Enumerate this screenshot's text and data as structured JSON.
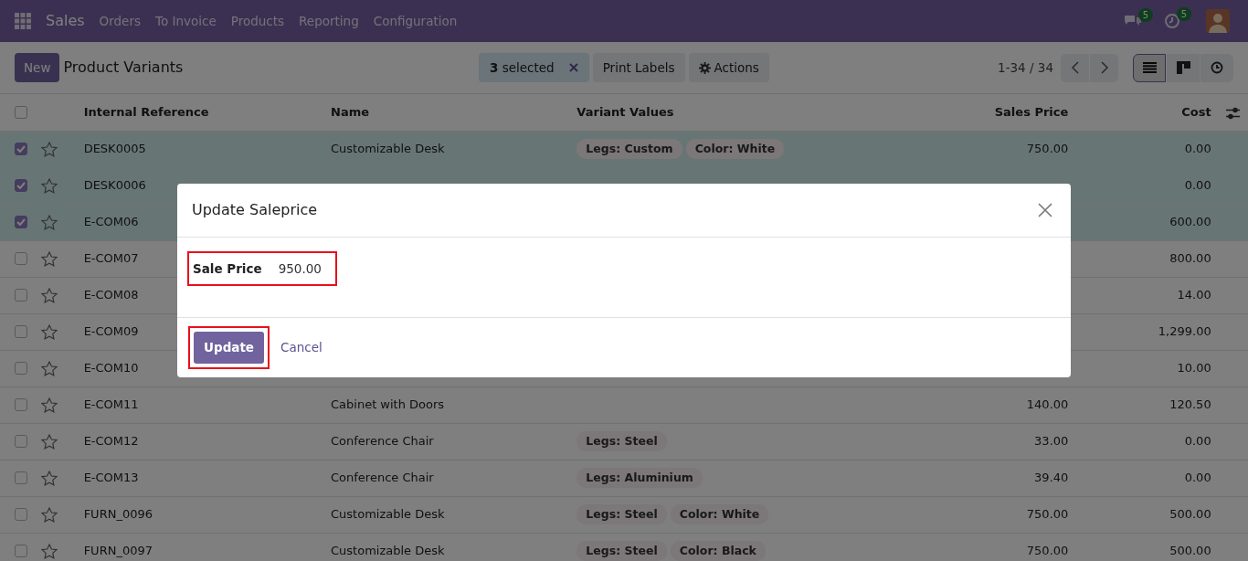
{
  "navbar": {
    "app": "Sales",
    "menus": [
      "Orders",
      "To Invoice",
      "Products",
      "Reporting",
      "Configuration"
    ],
    "messages_badge": "5",
    "activities_badge": "5"
  },
  "control_panel": {
    "new_button": "New",
    "title": "Product Variants",
    "selection": "**3** selected",
    "buttons": [
      {
        "kind": "plain",
        "label": "Print Labels"
      },
      {
        "kind": "gear",
        "label": "Actions"
      }
    ],
    "pager": "1-34 / 34",
    "views": [
      {
        "kind": "list",
        "selected": true
      },
      {
        "kind": "kanban",
        "selected": false
      },
      {
        "kind": "activity",
        "selected": false
      }
    ]
  },
  "table": {
    "all_selected": false,
    "columns": [
      "Internal Reference",
      "Name",
      "Variant Values",
      "Sales Price",
      "Cost"
    ],
    "rows": [
      {
        "selected": true,
        "starred": false,
        "reference": "DESK0005",
        "name": "Customizable Desk",
        "variants": [
          "Legs: Custom",
          "Color: White"
        ],
        "sales_price": "750.00",
        "cost": "0.00"
      },
      {
        "selected": true,
        "starred": false,
        "reference": "DESK0006",
        "cost": "0.00"
      },
      {
        "selected": true,
        "starred": false,
        "reference": "E-COM06",
        "cost": "600.00"
      },
      {
        "selected": false,
        "starred": false,
        "reference": "E-COM07",
        "cost": "800.00"
      },
      {
        "selected": false,
        "starred": false,
        "reference": "E-COM08",
        "cost": "14.00"
      },
      {
        "selected": false,
        "starred": false,
        "reference": "E-COM09",
        "cost": "1,299.00"
      },
      {
        "selected": false,
        "starred": false,
        "reference": "E-COM10",
        "cost": "10.00"
      },
      {
        "selected": false,
        "starred": false,
        "reference": "E-COM11",
        "name": "Cabinet with Doors",
        "variants": [],
        "sales_price": "140.00",
        "cost": "120.50"
      },
      {
        "selected": false,
        "starred": false,
        "reference": "E-COM12",
        "name": "Conference Chair",
        "variants": [
          "Legs: Steel"
        ],
        "sales_price": "33.00",
        "cost": "0.00"
      },
      {
        "selected": false,
        "starred": false,
        "reference": "E-COM13",
        "name": "Conference Chair",
        "variants": [
          "Legs: Aluminium"
        ],
        "sales_price": "39.40",
        "cost": "0.00"
      },
      {
        "selected": false,
        "starred": false,
        "reference": "FURN_0096",
        "name": "Customizable Desk",
        "variants": [
          "Legs: Steel",
          "Color: White"
        ],
        "sales_price": "750.00",
        "cost": "500.00"
      },
      {
        "selected": false,
        "starred": false,
        "reference": "FURN_0097",
        "name": "Customizable Desk",
        "variants": [
          "Legs: Steel",
          "Color: Black"
        ],
        "sales_price": "750.00",
        "cost": "500.00"
      }
    ]
  },
  "dialog": {
    "title": "Update Saleprice",
    "field": {
      "label": "Sale Price",
      "value": "950.00"
    },
    "buttons": [
      {
        "kind": "primary",
        "label": "Update"
      },
      {
        "kind": "link",
        "label": "Cancel"
      }
    ]
  }
}
